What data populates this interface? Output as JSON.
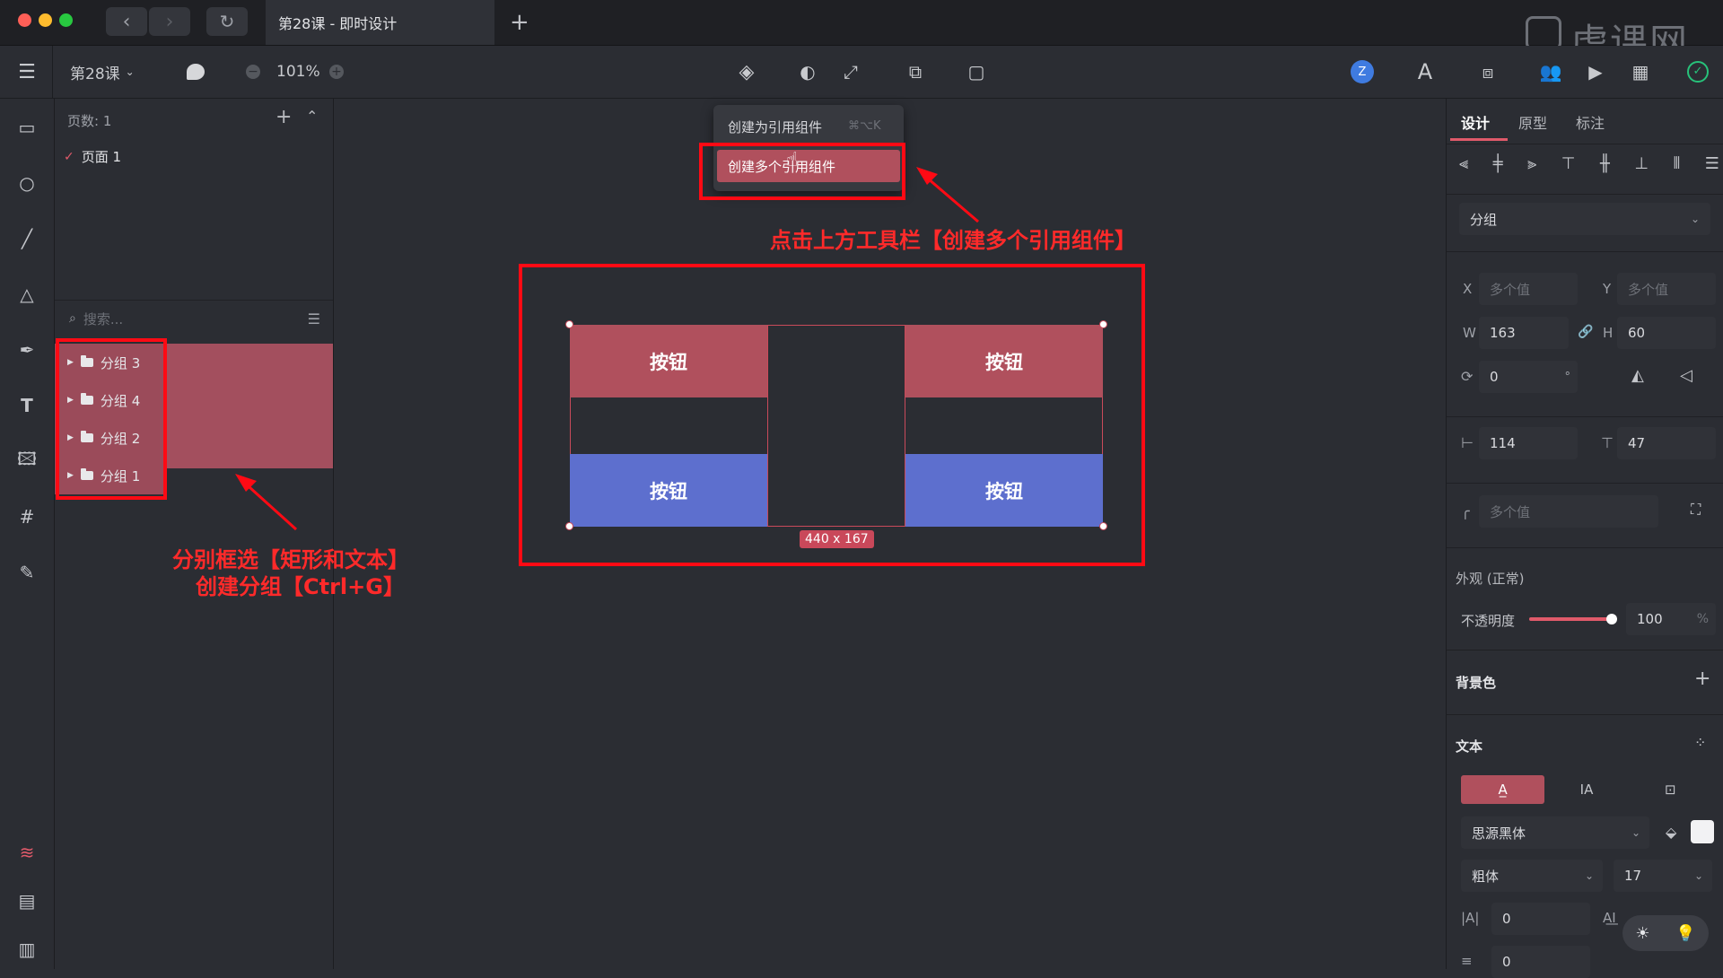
{
  "window": {
    "tab_title": "第28课 - 即时设计",
    "watermark": "虎课网"
  },
  "toolbar": {
    "file_name": "第28课",
    "zoom": "101%",
    "avatar_letter": "Z"
  },
  "layers_panel": {
    "pages_label": "页数: 1",
    "page_name": "页面 1",
    "search_placeholder": "搜索...",
    "layers": [
      "分组 3",
      "分组 4",
      "分组 2",
      "分组 1"
    ]
  },
  "context_menu": {
    "item1": "创建为引用组件",
    "item1_shortcut": "⌘⌥K",
    "item2": "创建多个引用组件"
  },
  "canvas": {
    "buttons": [
      "按钮",
      "按钮",
      "按钮",
      "按钮"
    ],
    "size_badge": "440 x 167",
    "colors": {
      "red_button": "#b0505d",
      "blue_button": "#5d6fce",
      "annotation": "#ff0a14"
    }
  },
  "annotations": {
    "top": "点击上方工具栏【创建多个引用组件】",
    "left_line1": "分别框选【矩形和文本】",
    "left_line2": "创建分组【Ctrl+G】"
  },
  "right_panel": {
    "tabs": [
      "设计",
      "原型",
      "标注"
    ],
    "group_type": "分组",
    "x_label": "X",
    "x_value": "多个值",
    "y_label": "Y",
    "y_value": "多个值",
    "w_label": "W",
    "w_value": "163",
    "h_label": "H",
    "h_value": "60",
    "rotation": "0",
    "rotation_unit": "°",
    "spacing_h": "114",
    "spacing_v": "47",
    "radius": "多个值",
    "appearance": "外观 (正常)",
    "opacity_label": "不透明度",
    "opacity_value": "100",
    "opacity_unit": "%",
    "background_label": "背景色",
    "text_label": "文本",
    "font_family": "思源黑体",
    "font_weight": "粗体",
    "font_size": "17",
    "letter_spacing": "0",
    "line_height": "0"
  }
}
